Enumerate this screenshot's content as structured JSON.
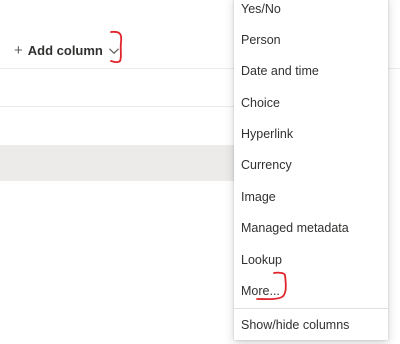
{
  "header": {
    "add_column_label": "Add column",
    "plus_icon": "+",
    "chevron_icon": "chevron-down-icon"
  },
  "menu": {
    "items": [
      {
        "label": "Yes/No"
      },
      {
        "label": "Person"
      },
      {
        "label": "Date and time"
      },
      {
        "label": "Choice"
      },
      {
        "label": "Hyperlink"
      },
      {
        "label": "Currency"
      },
      {
        "label": "Image"
      },
      {
        "label": "Managed metadata"
      },
      {
        "label": "Lookup"
      },
      {
        "label": "More..."
      }
    ],
    "footer_item": "Show/hide columns"
  },
  "colors": {
    "annotation": "#e0242b",
    "divider": "#edebe9",
    "row_band": "#edebe9"
  }
}
